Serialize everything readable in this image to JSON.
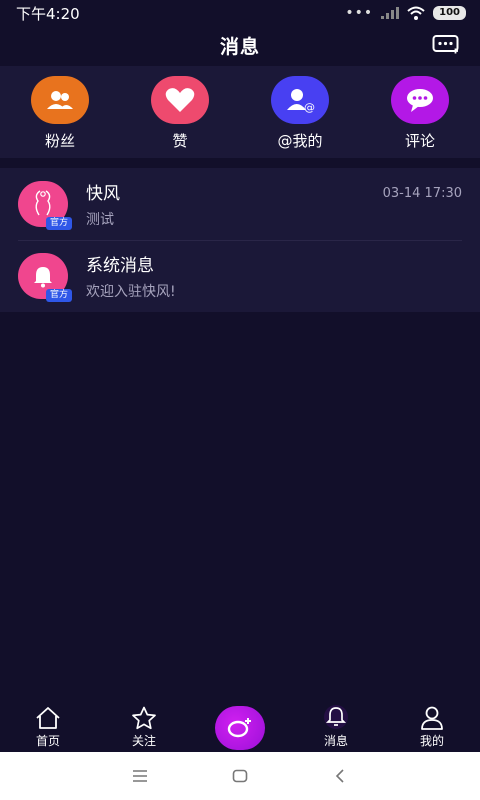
{
  "status_bar": {
    "time": "下午4:20",
    "signal_dots": "•••",
    "battery": "100"
  },
  "header": {
    "title": "消息"
  },
  "quick_actions": [
    {
      "label": "粉丝",
      "color": "#e8731e",
      "icon": "fans-icon"
    },
    {
      "label": "赞",
      "color": "#ee4a6e",
      "icon": "heart-icon"
    },
    {
      "label": "@我的",
      "color": "#4840f2",
      "icon": "mention-icon"
    },
    {
      "label": "评论",
      "color": "#b318e6",
      "icon": "comment-icon"
    }
  ],
  "messages": [
    {
      "title": "快风",
      "preview": "测试",
      "time": "03-14 17:30",
      "badge": "官方",
      "avatar_color": "#f0468e"
    },
    {
      "title": "系统消息",
      "preview": "欢迎入驻快风!",
      "time": "",
      "badge": "官方",
      "avatar_color": "#f0468e"
    }
  ],
  "tabs": [
    {
      "label": "首页",
      "icon": "home-icon"
    },
    {
      "label": "关注",
      "icon": "star-icon"
    },
    {
      "label": "",
      "icon": "camera-add-icon"
    },
    {
      "label": "消息",
      "icon": "bell-icon"
    },
    {
      "label": "我的",
      "icon": "person-icon"
    }
  ],
  "colors": {
    "background": "#120f2a",
    "panel": "#1b1838",
    "accent": "#b318e6"
  }
}
